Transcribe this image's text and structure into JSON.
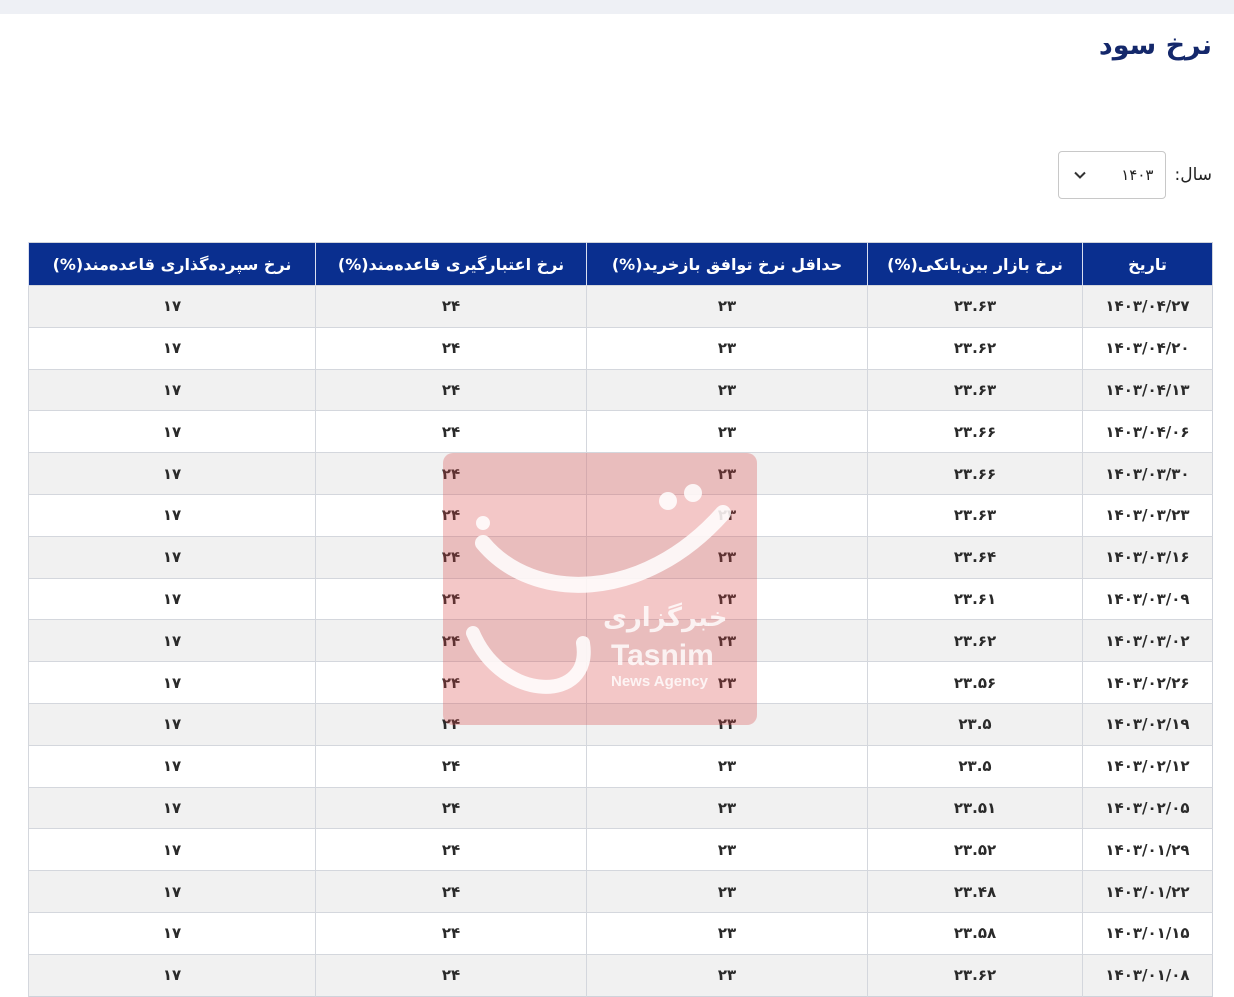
{
  "page": {
    "title": "نرخ سود"
  },
  "filter": {
    "year_label": "سال:",
    "year_value": "۱۴۰۳"
  },
  "watermark": {
    "text_fa": "خبرگزاری",
    "text_en": "Tasnim",
    "text_en_sub": "News Agency"
  },
  "table": {
    "headers": [
      "تاریخ",
      "نرخ بازار بین‌بانکی(%)",
      "حداقل نرخ توافق بازخرید(%)",
      "نرخ اعتبارگیری قاعده‌مند(%)",
      "نرخ سپرده‌گذاری قاعده‌مند(%)"
    ],
    "rows": [
      [
        "۱۴۰۳/۰۴/۲۷",
        "۲۳.۶۳",
        "۲۳",
        "۲۴",
        "۱۷"
      ],
      [
        "۱۴۰۳/۰۴/۲۰",
        "۲۳.۶۲",
        "۲۳",
        "۲۴",
        "۱۷"
      ],
      [
        "۱۴۰۳/۰۴/۱۳",
        "۲۳.۶۳",
        "۲۳",
        "۲۴",
        "۱۷"
      ],
      [
        "۱۴۰۳/۰۴/۰۶",
        "۲۳.۶۶",
        "۲۳",
        "۲۴",
        "۱۷"
      ],
      [
        "۱۴۰۳/۰۳/۳۰",
        "۲۳.۶۶",
        "۲۳",
        "۲۴",
        "۱۷"
      ],
      [
        "۱۴۰۳/۰۳/۲۳",
        "۲۳.۶۳",
        "۲۳",
        "۲۴",
        "۱۷"
      ],
      [
        "۱۴۰۳/۰۳/۱۶",
        "۲۳.۶۴",
        "۲۳",
        "۲۴",
        "۱۷"
      ],
      [
        "۱۴۰۳/۰۳/۰۹",
        "۲۳.۶۱",
        "۲۳",
        "۲۴",
        "۱۷"
      ],
      [
        "۱۴۰۳/۰۳/۰۲",
        "۲۳.۶۲",
        "۲۳",
        "۲۴",
        "۱۷"
      ],
      [
        "۱۴۰۳/۰۲/۲۶",
        "۲۳.۵۶",
        "۲۳",
        "۲۴",
        "۱۷"
      ],
      [
        "۱۴۰۳/۰۲/۱۹",
        "۲۳.۵",
        "۲۳",
        "۲۴",
        "۱۷"
      ],
      [
        "۱۴۰۳/۰۲/۱۲",
        "۲۳.۵",
        "۲۳",
        "۲۴",
        "۱۷"
      ],
      [
        "۱۴۰۳/۰۲/۰۵",
        "۲۳.۵۱",
        "۲۳",
        "۲۴",
        "۱۷"
      ],
      [
        "۱۴۰۳/۰۱/۲۹",
        "۲۳.۵۲",
        "۲۳",
        "۲۴",
        "۱۷"
      ],
      [
        "۱۴۰۳/۰۱/۲۲",
        "۲۳.۴۸",
        "۲۳",
        "۲۴",
        "۱۷"
      ],
      [
        "۱۴۰۳/۰۱/۱۵",
        "۲۳.۵۸",
        "۲۳",
        "۲۴",
        "۱۷"
      ],
      [
        "۱۴۰۳/۰۱/۰۸",
        "۲۳.۶۲",
        "۲۳",
        "۲۴",
        "۱۷"
      ]
    ]
  },
  "colors": {
    "header_bg": "#0a2f8f",
    "header_text": "#ffffff",
    "title": "#14286b",
    "row_alt": "#f1f1f1"
  },
  "icons": {
    "year_select": "chevron-down-icon",
    "watermark": "tasnim-logo-icon"
  }
}
